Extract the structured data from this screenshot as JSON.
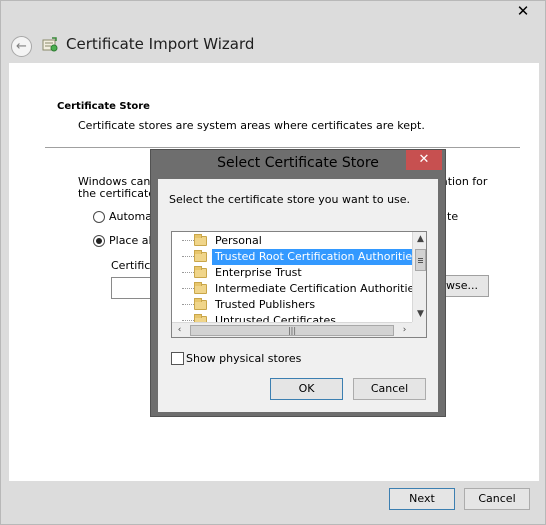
{
  "window": {
    "title": "Certificate Import Wizard",
    "close_glyph": "✕",
    "back_glyph": "←"
  },
  "page": {
    "heading": "Certificate Store",
    "description": "Certificate stores are system areas where certificates are kept."
  },
  "background": {
    "line1_left": "Windows can a",
    "line1_right": "ation for",
    "line2": "the certificate.",
    "option_auto_left": "Automati",
    "option_auto_right": "te",
    "option_auto_selected": false,
    "option_place_left": "Place all",
    "option_place_selected": true,
    "field_label": "Certifica",
    "browse_label": "wse..."
  },
  "footer": {
    "next_label": "Next",
    "cancel_label": "Cancel"
  },
  "dialog": {
    "title": "Select Certificate Store",
    "close_glyph": "✕",
    "instruction": "Select the certificate store you want to use.",
    "stores": [
      {
        "label": "Personal",
        "selected": false
      },
      {
        "label": "Trusted Root Certification Authorities",
        "selected": true
      },
      {
        "label": "Enterprise Trust",
        "selected": false
      },
      {
        "label": "Intermediate Certification Authorities",
        "selected": false
      },
      {
        "label": "Trusted Publishers",
        "selected": false
      },
      {
        "label": "Untrusted Certificates",
        "selected": false
      }
    ],
    "show_physical_label": "Show physical stores",
    "show_physical_checked": false,
    "ok_label": "OK",
    "cancel_label": "Cancel"
  },
  "colors": {
    "selection": "#3399ff",
    "dialog_close": "#c75050",
    "dialog_frame": "#6e6e6e"
  }
}
